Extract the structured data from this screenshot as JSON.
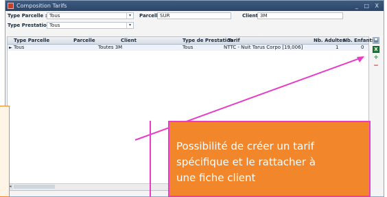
{
  "window": {
    "title": "Composition Tarifs",
    "controls": "_ □ X"
  },
  "filters": {
    "type_parcelle": {
      "label": "Type Parcelle :",
      "value": "Tous"
    },
    "parcelles": {
      "label": "Parcelles :",
      "value": "SUR"
    },
    "client": {
      "label": "Client :",
      "value": "3M"
    },
    "type_prestation": {
      "label": "Type Prestation :",
      "value": "Tous"
    }
  },
  "grid": {
    "columns": [
      "Type Parcelle",
      "Parcelle",
      "Client",
      "Type de Prestation",
      "Tarif",
      "Nb. Adultes",
      "Nb. Enfants"
    ],
    "rows": [
      {
        "indicator": "►",
        "type_parcelle": "Tous",
        "parcelle": "",
        "client": "Toutes 3M",
        "type_prestation": "Tous",
        "tarif": "NTTC - Nuit Tarus Corpo [19,006]",
        "nb_adultes": "1",
        "nb_enfants": "0"
      }
    ]
  },
  "toolbar": {
    "icons": [
      "save-icon",
      "excel-icon",
      "add-icon",
      "remove-icon"
    ],
    "add_symbol": "+",
    "remove_symbol": "−"
  },
  "callout": {
    "lines": [
      "Possibilité de créer un tarif",
      "spécifique et le rattacher à",
      "une fiche client"
    ],
    "colors": {
      "fill": "#f2862b",
      "border": "#e83cc8",
      "arrow": "#e83cc8"
    }
  }
}
